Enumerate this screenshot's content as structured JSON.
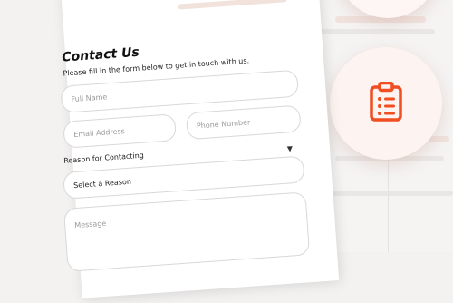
{
  "form": {
    "title": "Contact Us",
    "subtitle": "Please fill in the form below to get in touch with us.",
    "full_name_placeholder": "Full Name",
    "email_placeholder": "Email Address",
    "phone_placeholder": "Phone Number",
    "reason_label": "Reason for Contacting",
    "reason_selected": "Select a Reason",
    "message_placeholder": "Message"
  },
  "decor": {
    "accent_color": "#f04e23",
    "circle_icon": "clipboard-list-icon"
  }
}
